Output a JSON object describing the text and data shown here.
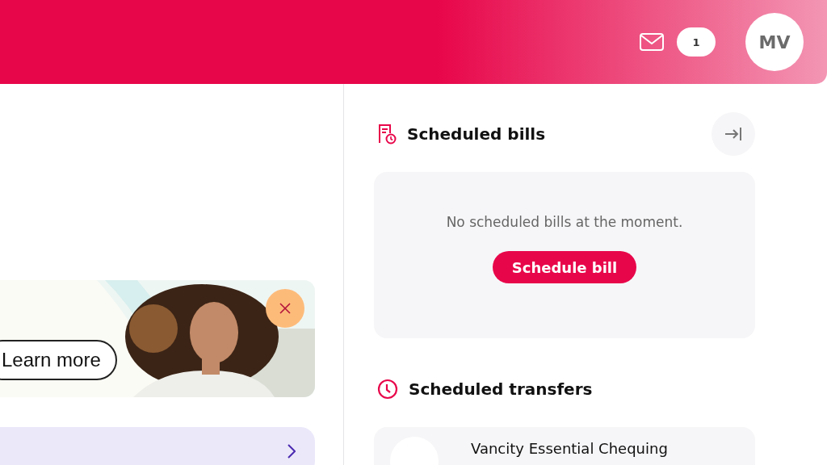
{
  "header": {
    "unread_count": "1",
    "avatar_initials": "MV"
  },
  "promo_banner": {
    "button": "Learn more"
  },
  "scheduled_bills": {
    "title": "Scheduled bills",
    "empty_message": "No scheduled bills at the moment.",
    "button": "Schedule bill"
  },
  "scheduled_transfers": {
    "title": "Scheduled transfers",
    "items": [
      {
        "account": "Vancity Essential Chequing"
      }
    ]
  }
}
